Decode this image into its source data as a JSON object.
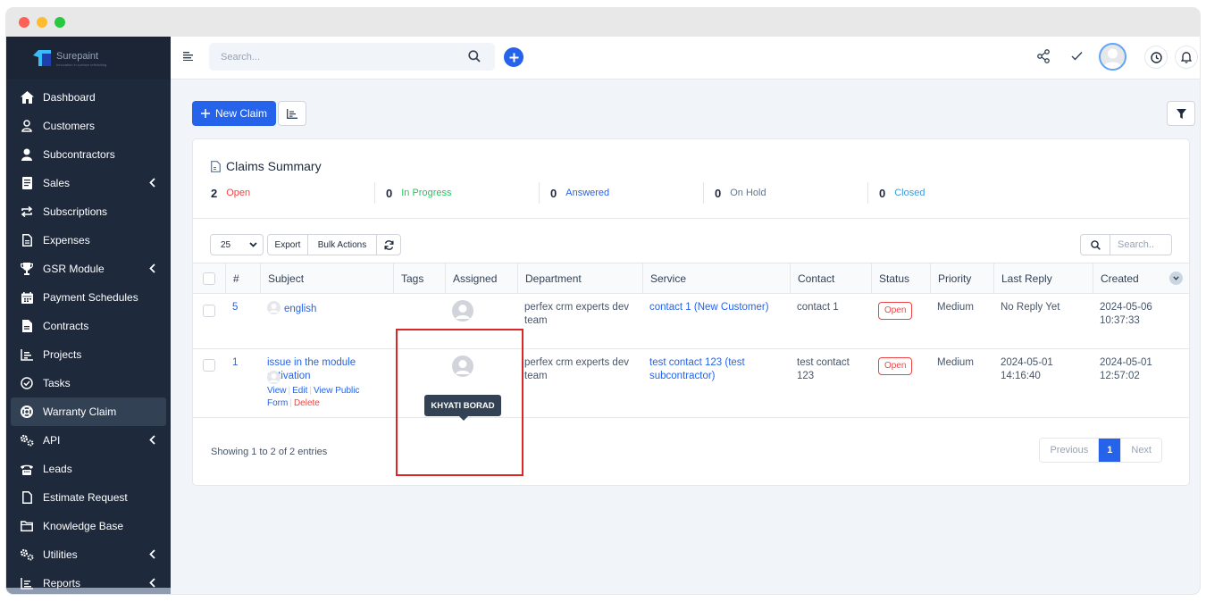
{
  "brand": {
    "name": "Surepaint",
    "tagline": "Innovation in surface refinishing"
  },
  "search": {
    "placeholder": "Search..."
  },
  "sidebar": {
    "items": [
      {
        "label": "Dashboard",
        "icon": "home-icon"
      },
      {
        "label": "Customers",
        "icon": "user-outline-icon"
      },
      {
        "label": "Subcontractors",
        "icon": "user-solid-icon"
      },
      {
        "label": "Sales",
        "icon": "receipt-icon",
        "has_submenu": true
      },
      {
        "label": "Subscriptions",
        "icon": "repeat-icon"
      },
      {
        "label": "Expenses",
        "icon": "file-text-icon"
      },
      {
        "label": "GSR Module",
        "icon": "trophy-icon",
        "has_submenu": true
      },
      {
        "label": "Payment Schedules",
        "icon": "calendar-icon"
      },
      {
        "label": "Contracts",
        "icon": "contract-icon"
      },
      {
        "label": "Projects",
        "icon": "chart-bars-icon"
      },
      {
        "label": "Tasks",
        "icon": "check-circle-icon"
      },
      {
        "label": "Warranty Claim",
        "icon": "lifebuoy-icon",
        "active": true
      },
      {
        "label": "API",
        "icon": "cogs-icon",
        "has_submenu": true
      },
      {
        "label": "Leads",
        "icon": "phone-icon"
      },
      {
        "label": "Estimate Request",
        "icon": "file-icon"
      },
      {
        "label": "Knowledge Base",
        "icon": "folder-icon"
      },
      {
        "label": "Utilities",
        "icon": "cogs-icon",
        "has_submenu": true
      },
      {
        "label": "Reports",
        "icon": "chart-line-icon",
        "has_submenu": true
      }
    ]
  },
  "toolbar": {
    "new_claim_label": "New Claim"
  },
  "summary": {
    "title": "Claims Summary",
    "stats": [
      {
        "count": "2",
        "label": "Open",
        "color": "#ef4444"
      },
      {
        "count": "0",
        "label": "In Progress",
        "color": "#22c55e"
      },
      {
        "count": "0",
        "label": "Answered",
        "color": "#2563eb"
      },
      {
        "count": "0",
        "label": "On Hold",
        "color": "#64748b"
      },
      {
        "count": "0",
        "label": "Closed",
        "color": "#3b9ad9"
      }
    ]
  },
  "table_controls": {
    "page_length": "25",
    "export_label": "Export",
    "bulk_actions_label": "Bulk Actions",
    "search_placeholder": "Search.."
  },
  "table": {
    "columns": [
      "#",
      "Subject",
      "Tags",
      "Assigned",
      "Department",
      "Service",
      "Contact",
      "Status",
      "Priority",
      "Last Reply",
      "Created"
    ],
    "rows": [
      {
        "id": "5",
        "subject": "english",
        "department": "perfex crm experts dev team",
        "service": "contact 1 (New Customer)",
        "contact": "contact 1",
        "status": "Open",
        "priority": "Medium",
        "last_reply": "No Reply Yet",
        "created": "2024-05-06 10:37:33"
      },
      {
        "id": "1",
        "subject": "issue in the module activation",
        "actions": {
          "view": "View",
          "edit": "Edit",
          "view_public": "View Public Form",
          "delete": "Delete"
        },
        "department": "perfex crm experts dev team",
        "service": "test contact 123 (test subcontractor)",
        "contact": "test contact 123",
        "status": "Open",
        "priority": "Medium",
        "last_reply": "2024-05-01 14:16:40",
        "created": "2024-05-01 12:57:02"
      }
    ]
  },
  "tooltip": {
    "text": "KHYATI BORAD"
  },
  "footer": {
    "info": "Showing 1 to 2 of 2 entries",
    "previous": "Previous",
    "current_page": "1",
    "next": "Next"
  }
}
